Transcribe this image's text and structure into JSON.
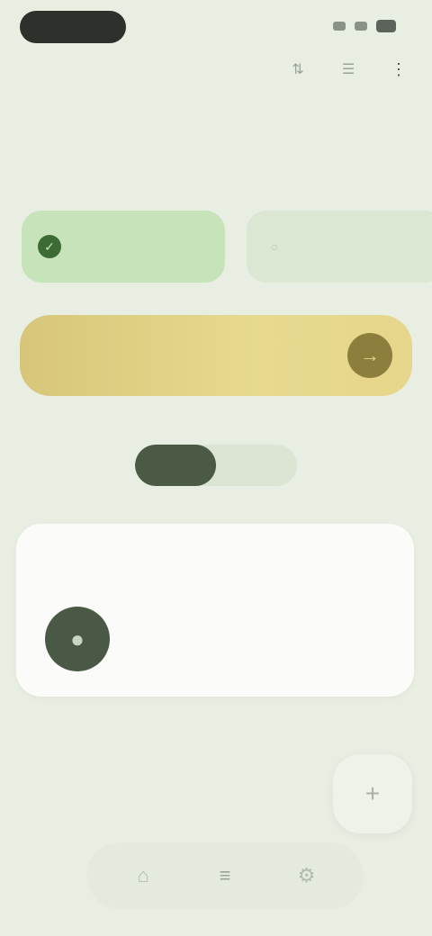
{
  "status_bar": {
    "icons": [
      "signal-icon",
      "wifi-icon",
      "battery-icon"
    ]
  },
  "top_actions": [
    {
      "name": "sort-icon",
      "glyph": "⇅"
    },
    {
      "name": "filter-icon",
      "glyph": "☰"
    },
    {
      "name": "more-icon",
      "glyph": "⋮"
    }
  ],
  "header": {
    "title": "",
    "subtitle": ""
  },
  "chips": [
    {
      "label": "",
      "icon": "✓",
      "active": true
    },
    {
      "label": "",
      "icon": "○",
      "active": false
    }
  ],
  "banner": {
    "text": "",
    "button_icon": "→"
  },
  "segmented": {
    "options": [
      "",
      ""
    ],
    "selected_index": 0
  },
  "card": {
    "title": "",
    "avatar_icon": "●",
    "line1": "",
    "line2": ""
  },
  "fab": {
    "icon": "+"
  },
  "bottom_nav": [
    {
      "name": "home-icon",
      "glyph": "⌂",
      "active": false
    },
    {
      "name": "list-icon",
      "glyph": "≡",
      "active": true
    },
    {
      "name": "settings-icon",
      "glyph": "⚙",
      "active": false
    }
  ],
  "colors": {
    "background": "#e9eee2",
    "active_chip": "#c6e3b9",
    "banner": "#e5d68c",
    "dark_accent": "#4b5a45"
  }
}
